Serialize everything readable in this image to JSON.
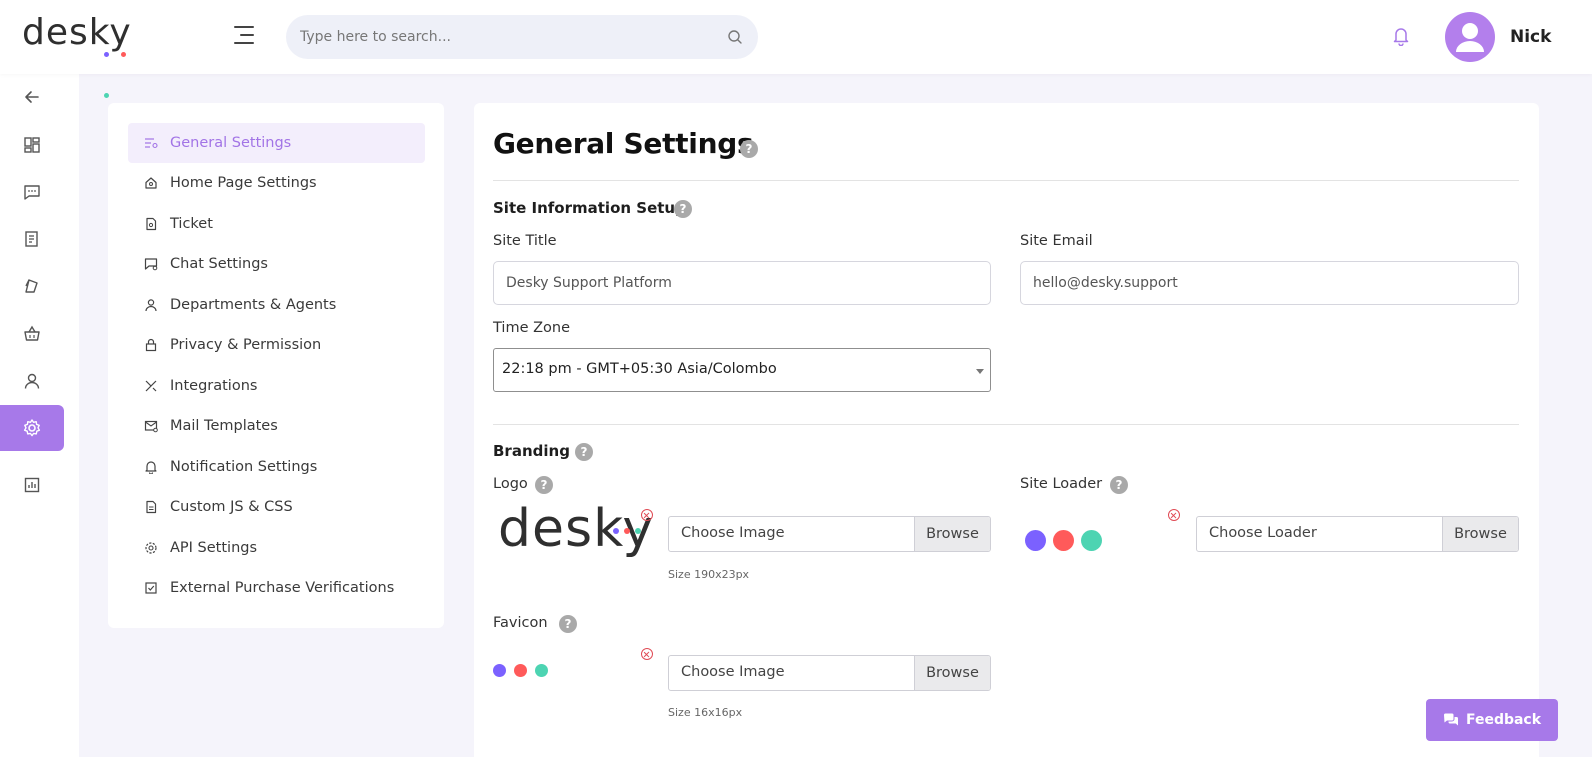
{
  "brand": {
    "logo_text": "desky",
    "dot_colors": [
      "#7b61ff",
      "#ff5a5a",
      "#4dd4b2"
    ]
  },
  "header": {
    "search_placeholder": "Type here to search...",
    "user_name": "Nick",
    "accent": "#a779e9"
  },
  "rail": {
    "items": [
      {
        "icon": "back-arrow-icon"
      },
      {
        "icon": "dashboard-icon"
      },
      {
        "icon": "chat-icon"
      },
      {
        "icon": "ticket-list-icon"
      },
      {
        "icon": "tags-icon"
      },
      {
        "icon": "basket-icon"
      },
      {
        "icon": "user-icon"
      },
      {
        "icon": "gear-icon",
        "active": true
      },
      {
        "icon": "reports-icon"
      }
    ]
  },
  "settings_nav": {
    "items": [
      {
        "label": "General Settings",
        "icon": "settings-list-icon",
        "active": true
      },
      {
        "label": "Home Page Settings",
        "icon": "home-icon"
      },
      {
        "label": "Ticket",
        "icon": "ticket-icon"
      },
      {
        "label": "Chat Settings",
        "icon": "chat-settings-icon"
      },
      {
        "label": "Departments & Agents",
        "icon": "agent-icon"
      },
      {
        "label": "Privacy & Permission",
        "icon": "lock-icon"
      },
      {
        "label": "Integrations",
        "icon": "tools-icon"
      },
      {
        "label": "Mail Templates",
        "icon": "mail-icon"
      },
      {
        "label": "Notification Settings",
        "icon": "bell-icon"
      },
      {
        "label": "Custom JS & CSS",
        "icon": "code-file-icon"
      },
      {
        "label": "API Settings",
        "icon": "gear-small-icon"
      },
      {
        "label": "External Purchase Verifications",
        "icon": "check-box-icon"
      }
    ]
  },
  "main": {
    "title": "General Settings",
    "site_info": {
      "section_title": "Site Information Setup",
      "site_title_label": "Site Title",
      "site_title_value": "Desky Support Platform",
      "site_email_label": "Site Email",
      "site_email_value": "hello@desky.support",
      "timezone_label": "Time Zone",
      "timezone_value": "22:18 pm - GMT+05:30 Asia/Colombo"
    },
    "branding": {
      "section_title": "Branding",
      "logo_label": "Logo",
      "logo_input_placeholder": "Choose Image",
      "logo_size_note": "Size 190x23px",
      "loader_label": "Site Loader",
      "loader_input_placeholder": "Choose Loader",
      "favicon_label": "Favicon",
      "favicon_input_placeholder": "Choose Image",
      "favicon_size_note": "Size 16x16px",
      "browse_label": "Browse"
    }
  },
  "feedback_label": "Feedback",
  "help_glyph": "?"
}
